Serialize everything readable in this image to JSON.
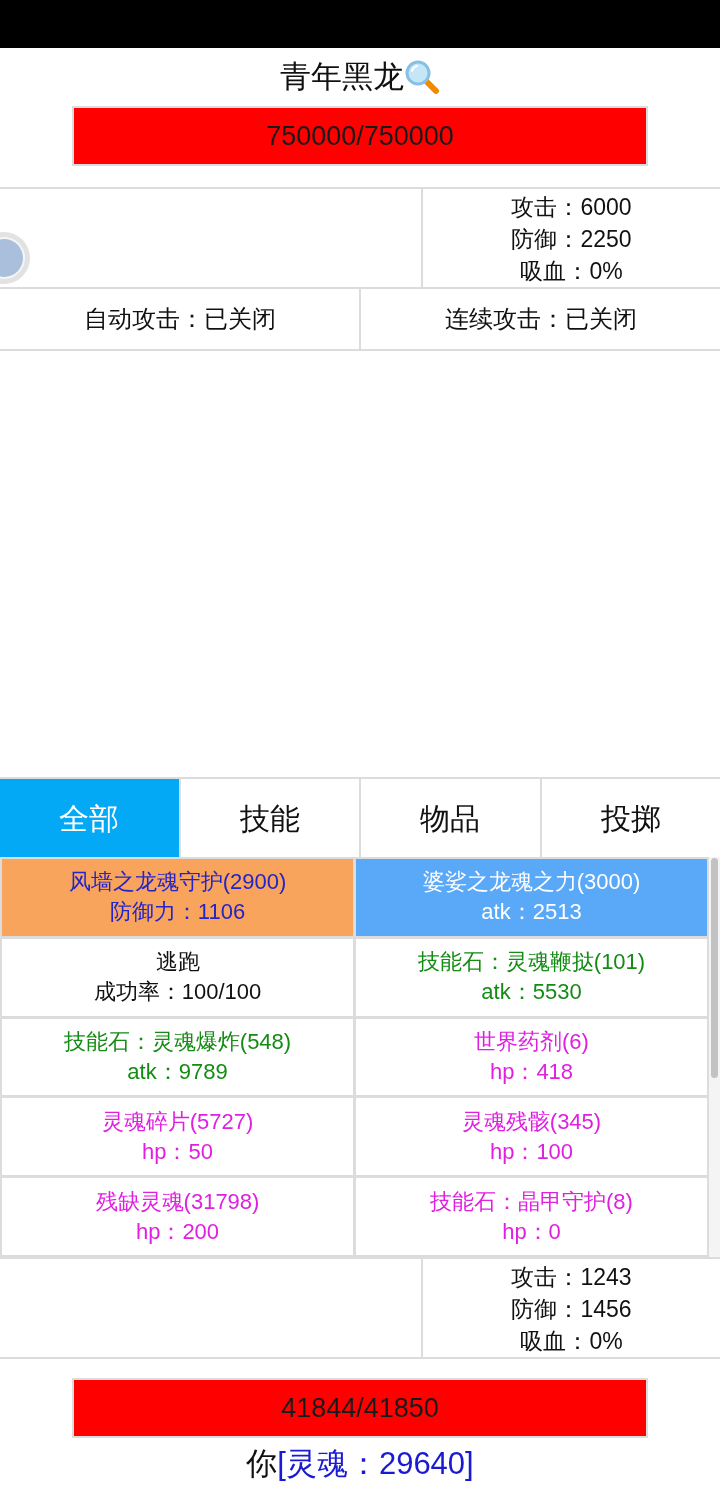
{
  "enemy": {
    "name": "青年黑龙",
    "hp": {
      "text": "750000/750000",
      "level": 1
    },
    "stats": [
      "攻击：6000",
      "防御：2250",
      "吸血：0%"
    ]
  },
  "toggles": [
    {
      "text": "自动攻击：已关闭"
    },
    {
      "text": "连续攻击：已关闭"
    }
  ],
  "tabs": [
    {
      "label": "全部",
      "selected": true
    },
    {
      "label": "技能",
      "selected": false
    },
    {
      "label": "物品",
      "selected": false
    },
    {
      "label": "投掷",
      "selected": false
    }
  ],
  "items": [
    {
      "kind": "guard",
      "name": "风墙之龙魂守护(2900)",
      "detail": "防御力：1106"
    },
    {
      "kind": "power",
      "name": "婆娑之龙魂之力(3000)",
      "detail": "atk：2513"
    },
    {
      "kind": "escape",
      "name": "逃跑",
      "detail": "成功率：100/100"
    },
    {
      "kind": "attack",
      "name": "技能石：灵魂鞭挞(101)",
      "detail": "atk：5530"
    },
    {
      "kind": "attack",
      "name": "技能石：灵魂爆炸(548)",
      "detail": "atk：9789"
    },
    {
      "kind": "heal",
      "name": "世界药剂(6)",
      "detail": "hp：418"
    },
    {
      "kind": "heal",
      "name": "灵魂碎片(5727)",
      "detail": "hp：50"
    },
    {
      "kind": "heal",
      "name": "灵魂残骸(345)",
      "detail": "hp：100"
    },
    {
      "kind": "heal",
      "name": "残缺灵魂(31798)",
      "detail": "hp：200"
    },
    {
      "kind": "heal",
      "name": "技能石：晶甲守护(8)",
      "detail": "hp：0"
    }
  ],
  "player": {
    "stats": [
      "攻击：1243",
      "防御：1456",
      "吸血：0%"
    ],
    "hp": {
      "text": "41844/41850",
      "level": 0.9999
    },
    "name": "你",
    "soul": "[灵魂：29640]"
  }
}
